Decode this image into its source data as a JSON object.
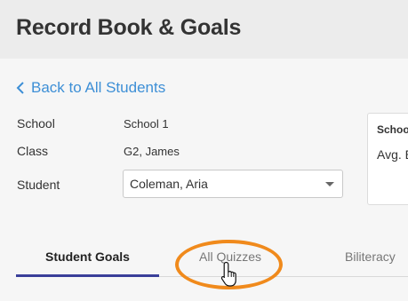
{
  "header": {
    "title": "Record Book & Goals"
  },
  "nav": {
    "back_label": "Back to All Students"
  },
  "info": {
    "school_label": "School",
    "school_value": "School 1",
    "class_label": "Class",
    "class_value": "G2, James",
    "student_label": "Student",
    "student_selected": "Coleman, Aria"
  },
  "card": {
    "title": "Schoo",
    "subtitle": "Avg. E"
  },
  "tabs": [
    {
      "label": "Student Goals",
      "active": true
    },
    {
      "label": "All Quizzes",
      "active": false
    },
    {
      "label": "Biliteracy",
      "active": false
    }
  ],
  "colors": {
    "link": "#3d8fd6",
    "tab_underline": "#3a3f99",
    "highlight_ring": "#f08a1c"
  },
  "icons": {
    "back": "chevron-left-icon",
    "dropdown": "caret-down-icon",
    "pointer": "hand-pointer-icon"
  }
}
